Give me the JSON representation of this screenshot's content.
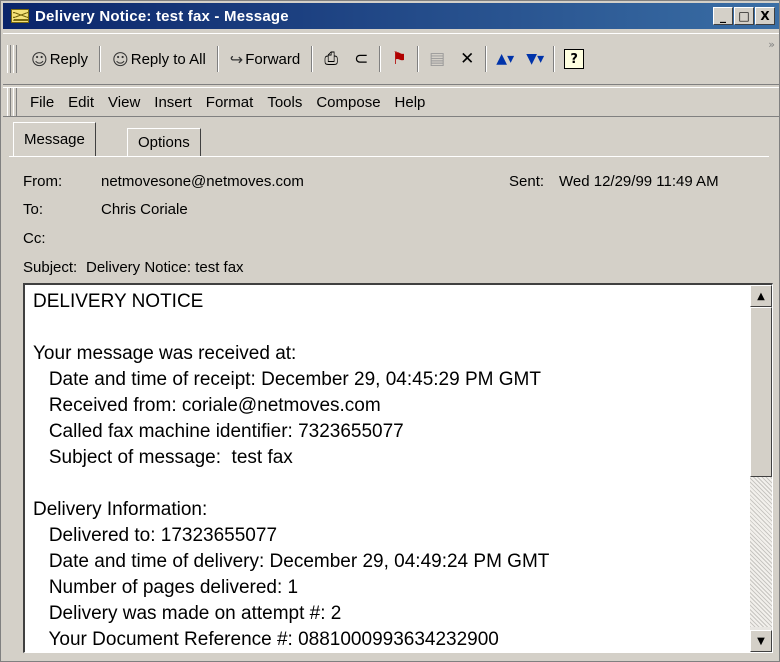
{
  "window": {
    "title": "Delivery Notice: test fax - Message",
    "controls": {
      "minimize": "_",
      "maximize": "□",
      "close": "X"
    }
  },
  "toolbar": {
    "reply": "Reply",
    "reply_all": "Reply to All",
    "forward": "Forward",
    "icons": [
      "print-icon",
      "attach-icon",
      "flag-icon",
      "move-icon",
      "delete-icon",
      "previous-icon",
      "next-icon",
      "help-icon"
    ],
    "help_glyph": "?"
  },
  "menu": [
    "File",
    "Edit",
    "View",
    "Insert",
    "Format",
    "Tools",
    "Compose",
    "Help"
  ],
  "tabs": [
    "Message",
    "Options"
  ],
  "header": {
    "from_label": "From:",
    "from_value": "netmovesone@netmoves.com",
    "sent_label": "Sent:",
    "sent_value": "Wed 12/29/99 11:49 AM",
    "to_label": "To:",
    "to_value": "Chris Coriale",
    "cc_label": "Cc:",
    "cc_value": "",
    "subject_label": "Subject:",
    "subject_value": "Delivery Notice: test fax"
  },
  "body": {
    "lines": [
      "DELIVERY NOTICE",
      "",
      "Your message was received at:",
      "   Date and time of receipt: December 29, 04:45:29 PM GMT",
      "   Received from: coriale@netmoves.com",
      "   Called fax machine identifier: 7323655077",
      "   Subject of message:  test fax",
      "",
      "Delivery Information:",
      "   Delivered to: 17323655077",
      "   Date and time of delivery: December 29, 04:49:24 PM GMT",
      "   Number of pages delivered: 1",
      "   Delivery was made on attempt #: 2",
      "   Your Document Reference #: 0881000993634232900"
    ]
  }
}
